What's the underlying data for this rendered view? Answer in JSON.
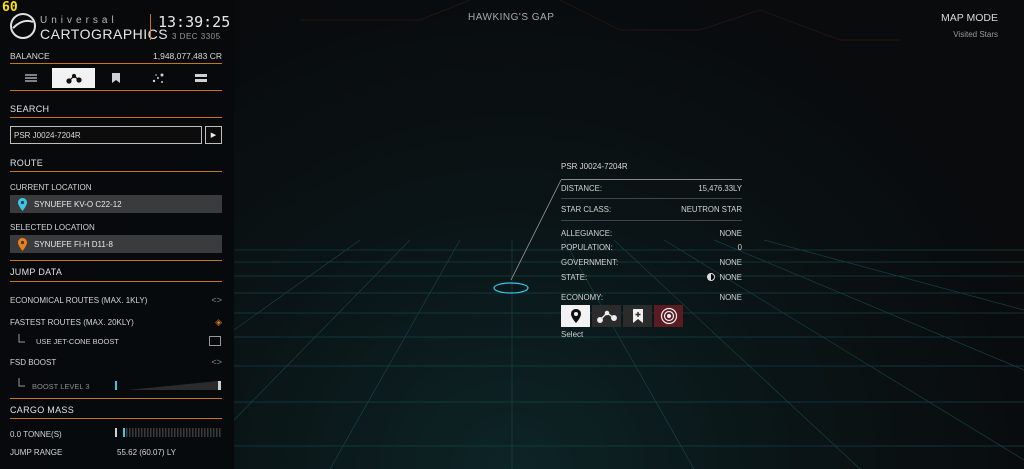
{
  "fps": "60",
  "header": {
    "brand_top": "Universal",
    "brand_main": "CARTOGRAPHICS",
    "time": "13:39:25",
    "date": "3 DEC 3305"
  },
  "balance": {
    "label": "BALANCE",
    "value": "1,948,077,483 CR"
  },
  "tabs": [
    {
      "icon": "list-icon"
    },
    {
      "icon": "route-icon",
      "active": true
    },
    {
      "icon": "bookmark-icon"
    },
    {
      "icon": "stars-icon"
    },
    {
      "icon": "storage-icon"
    }
  ],
  "search": {
    "title": "SEARCH",
    "value": "PSR J0024-7204R",
    "go_glyph": "▶"
  },
  "route": {
    "title": "ROUTE",
    "current_label": "CURRENT LOCATION",
    "current_value": "SYNUEFE KV-O C22-12",
    "selected_label": "SELECTED LOCATION",
    "selected_value": "SYNUEFE FI-H D11-8",
    "current_pin_color": "#3cc6e8",
    "selected_pin_color": "#f07d1a"
  },
  "jump_data": {
    "title": "JUMP DATA",
    "economical": "ECONOMICAL ROUTES (MAX. 1KLY)",
    "fastest": "FASTEST ROUTES (MAX. 20KLY)",
    "jet_cone": "USE JET-CONE BOOST",
    "fsd_boost": "FSD BOOST",
    "boost_level": "BOOST LEVEL 3",
    "arrows_glyph": "<>",
    "fastest_glyph": "◈"
  },
  "cargo": {
    "title": "CARGO MASS",
    "value": "0.0 TONNE(S)",
    "jump_range_label": "JUMP RANGE",
    "jump_range_value": "55.62 (60.07) LY"
  },
  "system_name": "HAWKING'S GAP",
  "map_mode": {
    "title": "MAP MODE",
    "sub": "Visited Stars"
  },
  "info": {
    "title": "PSR J0024-7204R",
    "distance_label": "DISTANCE:",
    "distance_value": "15,476.33LY",
    "star_class_label": "STAR CLASS:",
    "star_class_value": "NEUTRON STAR",
    "allegiance_label": "ALLEGIANCE:",
    "allegiance_value": "NONE",
    "population_label": "POPULATION:",
    "population_value": "0",
    "government_label": "GOVERNMENT:",
    "government_value": "NONE",
    "state_label": "STATE:",
    "state_value": "NONE",
    "economy_label": "ECONOMY:",
    "economy_value": "NONE",
    "select_label": "Select"
  },
  "colors": {
    "accent": "#c8741b",
    "grid": "#1f6a6e",
    "marker": "#3cc6e8"
  }
}
